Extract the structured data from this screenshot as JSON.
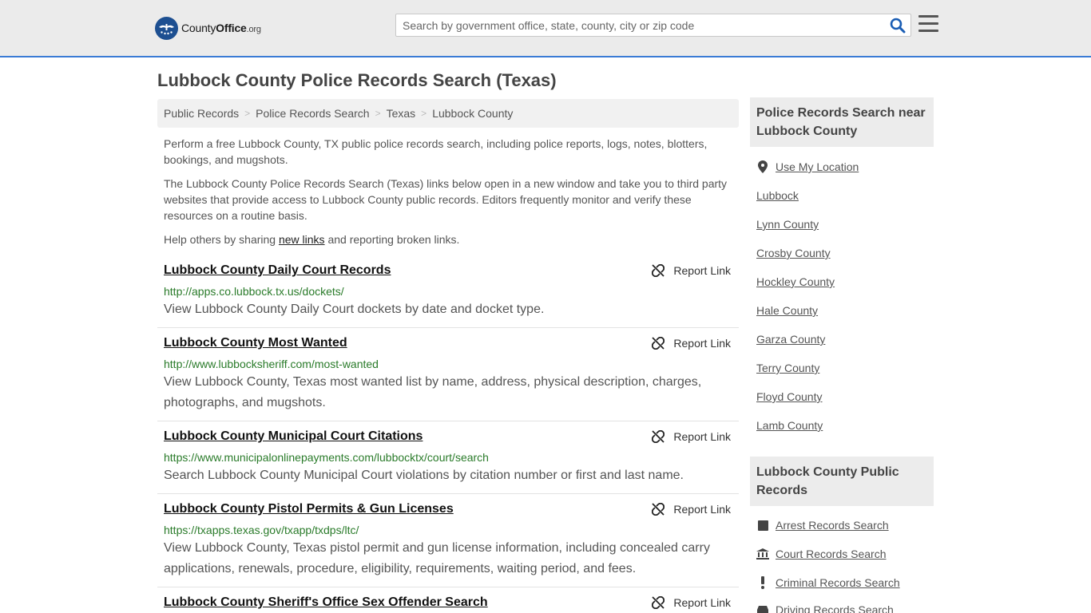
{
  "header": {
    "logo_main": "County",
    "logo_bold": "Office",
    "logo_suffix": ".org",
    "search_placeholder": "Search by government office, state, county, city or zip code"
  },
  "page": {
    "title": "Lubbock County Police Records Search (Texas)"
  },
  "breadcrumb": [
    "Public Records",
    "Police Records Search",
    "Texas",
    "Lubbock County"
  ],
  "intro": {
    "p1": "Perform a free Lubbock County, TX public police records search, including police reports, logs, notes, blotters, bookings, and mugshots.",
    "p2": "The Lubbock County Police Records Search (Texas) links below open in a new window and take you to third party websites that provide access to Lubbock County public records. Editors frequently monitor and verify these resources on a routine basis.",
    "p3_before": "Help others by sharing ",
    "p3_link": "new links",
    "p3_after": " and reporting broken links."
  },
  "report_label": "Report Link",
  "entries": [
    {
      "title": "Lubbock County Daily Court Records",
      "url": "http://apps.co.lubbock.tx.us/dockets/",
      "desc": "View Lubbock County Daily Court dockets by date and docket type."
    },
    {
      "title": "Lubbock County Most Wanted",
      "url": "http://www.lubbocksheriff.com/most-wanted",
      "desc": "View Lubbock County, Texas most wanted list by name, address, physical description, charges, photographs, and mugshots."
    },
    {
      "title": "Lubbock County Municipal Court Citations",
      "url": "https://www.municipalonlinepayments.com/lubbocktx/court/search",
      "desc": "Search Lubbock County Municipal Court violations by citation number or first and last name."
    },
    {
      "title": "Lubbock County Pistol Permits & Gun Licenses",
      "url": "https://txapps.texas.gov/txapp/txdps/ltc/",
      "desc": "View Lubbock County, Texas pistol permit and gun license information, including concealed carry applications, renewals, procedure, eligibility, requirements, waiting period, and fees."
    },
    {
      "title": "Lubbock County Sheriff's Office Sex Offender Search",
      "url": "",
      "desc": ""
    }
  ],
  "sidebar": {
    "near_heading": "Police Records Search near Lubbock County",
    "use_location": "Use My Location",
    "near_links": [
      "Lubbock",
      "Lynn County",
      "Crosby County",
      "Hockley County",
      "Hale County",
      "Garza County",
      "Terry County",
      "Floyd County",
      "Lamb County"
    ],
    "public_heading": "Lubbock County Public Records",
    "public_links": [
      {
        "label": "Arrest Records Search",
        "icon": "square-icon"
      },
      {
        "label": "Court Records Search",
        "icon": "courthouse-icon"
      },
      {
        "label": "Criminal Records Search",
        "icon": "exclamation-icon"
      },
      {
        "label": "Driving Records Search",
        "icon": "car-icon"
      }
    ]
  },
  "colors": {
    "accent_border": "#3a7bd5",
    "url_green": "#2a7b2a",
    "header_bg": "#ebebeb",
    "logo_blue": "#1d4f91",
    "search_icon": "#1a5db4"
  }
}
